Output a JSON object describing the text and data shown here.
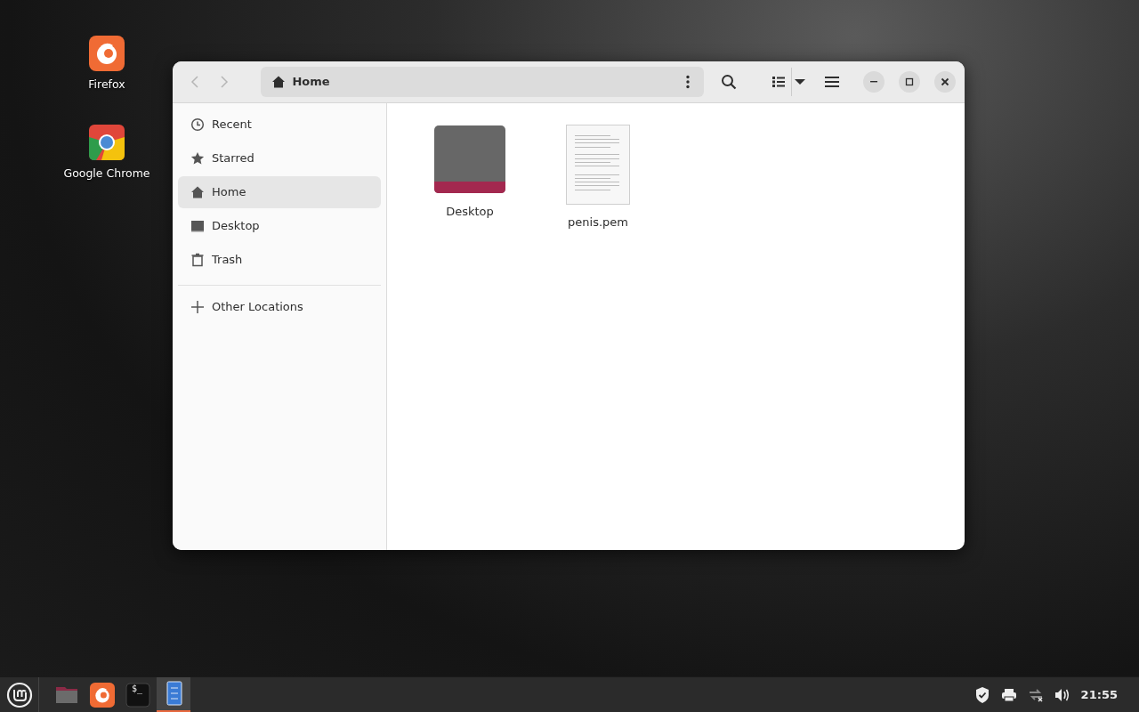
{
  "desktop_icons": [
    {
      "label": "Firefox",
      "kind": "firefox"
    },
    {
      "label": "Google Chrome",
      "kind": "chrome"
    }
  ],
  "window": {
    "path": "Home",
    "sidebar": [
      {
        "label": "Recent",
        "kind": "recent",
        "selected": false
      },
      {
        "label": "Starred",
        "kind": "starred",
        "selected": false
      },
      {
        "label": "Home",
        "kind": "home",
        "selected": true
      },
      {
        "label": "Desktop",
        "kind": "desktop",
        "selected": false
      },
      {
        "label": "Trash",
        "kind": "trash",
        "selected": false
      }
    ],
    "other_locations": "Other Locations",
    "files": [
      {
        "name": "Desktop",
        "kind": "folder"
      },
      {
        "name": "penis.pem",
        "kind": "document"
      }
    ]
  },
  "taskbar": {
    "apps": [
      {
        "kind": "files",
        "selected": false
      },
      {
        "kind": "firefox",
        "selected": false
      },
      {
        "kind": "terminal",
        "label": "$_",
        "selected": false
      },
      {
        "kind": "editor",
        "selected": true
      }
    ],
    "clock": "21:55"
  }
}
